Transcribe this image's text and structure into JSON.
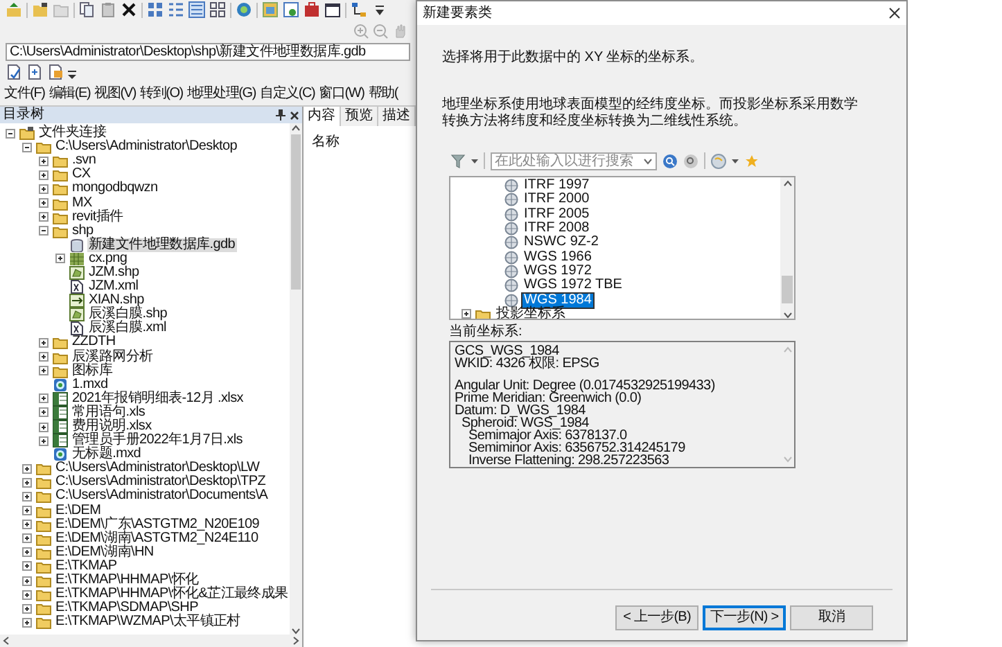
{
  "app": {
    "path": "C:\\Users\\Administrator\\Desktop\\shp\\新建文件地理数据库.gdb",
    "menu": [
      "文件(F)",
      "编辑(E)",
      "视图(V)",
      "转到(O)",
      "地理处理(G)",
      "自定义(C)",
      "窗口(W)",
      "帮助("
    ],
    "catalog": {
      "title": "目录树",
      "tree": [
        {
          "label": "文件夹连接",
          "kind": "connections",
          "expanded": true,
          "selected": false,
          "children": [
            {
              "label": "C:\\Users\\Administrator\\Desktop",
              "kind": "folder",
              "expanded": true,
              "selected": false,
              "children": [
                {
                  "label": ".svn",
                  "kind": "folder",
                  "expanded": false,
                  "selected": false
                },
                {
                  "label": "CX",
                  "kind": "folder",
                  "expanded": false,
                  "selected": false
                },
                {
                  "label": "mongodbqwzn",
                  "kind": "folder",
                  "expanded": false,
                  "selected": false
                },
                {
                  "label": "MX",
                  "kind": "folder",
                  "expanded": false,
                  "selected": false
                },
                {
                  "label": "revit插件",
                  "kind": "folder",
                  "expanded": false,
                  "selected": false
                },
                {
                  "label": "shp",
                  "kind": "folder",
                  "expanded": true,
                  "selected": false,
                  "children": [
                    {
                      "label": "新建文件地理数据库.gdb",
                      "kind": "gdb",
                      "selected": true
                    },
                    {
                      "label": "cx.png",
                      "kind": "raster",
                      "expanded": false,
                      "selected": false
                    },
                    {
                      "label": "JZM.shp",
                      "kind": "polygon",
                      "selected": false
                    },
                    {
                      "label": "JZM.xml",
                      "kind": "xml",
                      "selected": false
                    },
                    {
                      "label": "XIAN.shp",
                      "kind": "line",
                      "selected": false
                    },
                    {
                      "label": "辰溪白膜.shp",
                      "kind": "polygon",
                      "selected": false
                    },
                    {
                      "label": "辰溪白膜.xml",
                      "kind": "xml",
                      "selected": false
                    }
                  ]
                },
                {
                  "label": "ZZDTH",
                  "kind": "folder",
                  "expanded": false,
                  "selected": false
                },
                {
                  "label": "辰溪路网分析",
                  "kind": "folder",
                  "expanded": false,
                  "selected": false
                },
                {
                  "label": "图标库",
                  "kind": "folder",
                  "expanded": false,
                  "selected": false
                },
                {
                  "label": "1.mxd",
                  "kind": "mxd",
                  "selected": false
                },
                {
                  "label": "2021年报销明细表-12月 .xlsx",
                  "kind": "sheet",
                  "expanded": false,
                  "selected": false
                },
                {
                  "label": "常用语句.xls",
                  "kind": "sheet",
                  "expanded": false,
                  "selected": false
                },
                {
                  "label": "费用说明.xlsx",
                  "kind": "sheet",
                  "expanded": false,
                  "selected": false
                },
                {
                  "label": "管理员手册2022年1月7日.xls",
                  "kind": "sheet",
                  "expanded": false,
                  "selected": false
                },
                {
                  "label": "无标题.mxd",
                  "kind": "mxd",
                  "selected": false
                }
              ]
            },
            {
              "label": "C:\\Users\\Administrator\\Desktop\\LW",
              "kind": "folder",
              "expanded": false,
              "selected": false
            },
            {
              "label": "C:\\Users\\Administrator\\Desktop\\TPZ",
              "kind": "folder",
              "expanded": false,
              "selected": false
            },
            {
              "label": "C:\\Users\\Administrator\\Documents\\A",
              "kind": "folder",
              "expanded": false,
              "selected": false
            },
            {
              "label": "E:\\DEM",
              "kind": "folder",
              "expanded": false,
              "selected": false
            },
            {
              "label": "E:\\DEM\\广东\\ASTGTM2_N20E109",
              "kind": "folder",
              "expanded": false,
              "selected": false
            },
            {
              "label": "E:\\DEM\\湖南\\ASTGTM2_N24E110",
              "kind": "folder",
              "expanded": false,
              "selected": false
            },
            {
              "label": "E:\\DEM\\湖南\\HN",
              "kind": "folder",
              "expanded": false,
              "selected": false
            },
            {
              "label": "E:\\TKMAP",
              "kind": "folder",
              "expanded": false,
              "selected": false
            },
            {
              "label": "E:\\TKMAP\\HHMAP\\怀化",
              "kind": "folder",
              "expanded": false,
              "selected": false
            },
            {
              "label": "E:\\TKMAP\\HHMAP\\怀化&芷江最终成果",
              "kind": "folder",
              "expanded": false,
              "selected": false
            },
            {
              "label": "E:\\TKMAP\\SDMAP\\SHP",
              "kind": "folder",
              "expanded": false,
              "selected": false
            },
            {
              "label": "E:\\TKMAP\\WZMAP\\太平镇正村",
              "kind": "folder",
              "expanded": false,
              "selected": false
            }
          ]
        }
      ]
    },
    "content_panel": {
      "tabs": [
        {
          "label": "内容",
          "selected": true
        },
        {
          "label": "预览",
          "selected": false
        },
        {
          "label": "描述",
          "selected": false
        }
      ],
      "column": "名称"
    }
  },
  "dialog": {
    "title": "新建要素类",
    "prompt": "选择将用于此数据中的 XY 坐标的坐标系。",
    "description": "地理坐标系使用地球表面模型的经纬度坐标。而投影坐标系采用数学转换方法将纬度和经度坐标转换为二维线性系统。",
    "search": {
      "placeholder": "在此处输入以进行搜索"
    },
    "crs_list": [
      {
        "label": "ITRF 1997",
        "kind": "crs",
        "selected": false
      },
      {
        "label": "ITRF 2000",
        "kind": "crs",
        "selected": false
      },
      {
        "label": "ITRF 2005",
        "kind": "crs",
        "selected": false
      },
      {
        "label": "ITRF 2008",
        "kind": "crs",
        "selected": false
      },
      {
        "label": "NSWC 9Z-2",
        "kind": "crs",
        "selected": false
      },
      {
        "label": "WGS 1966",
        "kind": "crs",
        "selected": false
      },
      {
        "label": "WGS 1972",
        "kind": "crs",
        "selected": false
      },
      {
        "label": "WGS 1972 TBE",
        "kind": "crs",
        "selected": false
      },
      {
        "label": "WGS 1984",
        "kind": "crs",
        "selected": true
      },
      {
        "label": "投影坐标系",
        "kind": "folder",
        "selected": false
      }
    ],
    "current_label": "当前坐标系:",
    "current_details": [
      {
        "text": "GCS_WGS_1984"
      },
      {
        "text": "WKID: 4326 权限: EPSG"
      },
      {
        "text": "Angular Unit: Degree (0.0174532925199433)"
      },
      {
        "text": "Prime Meridian: Greenwich (0.0)"
      },
      {
        "text": "Datum: D_WGS_1984",
        "children": [
          {
            "text": "Spheroid: WGS_1984",
            "children": [
              {
                "text": "Semimajor Axis: 6378137.0"
              },
              {
                "text": "Semiminor Axis: 6356752.314245179"
              },
              {
                "text": "Inverse Flattening: 298.257223563"
              }
            ]
          }
        ]
      }
    ],
    "buttons": [
      {
        "label": "< 上一步(B)",
        "focused": false
      },
      {
        "label": "下一步(N) >",
        "focused": true
      },
      {
        "label": "取消",
        "focused": false
      }
    ]
  }
}
